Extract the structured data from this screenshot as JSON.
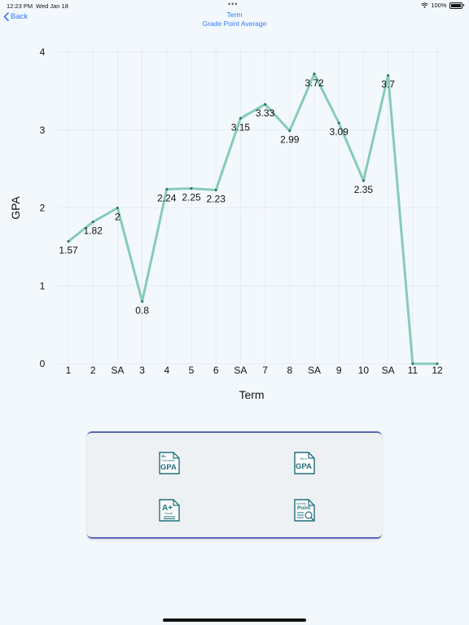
{
  "status_bar": {
    "time": "12:23 PM",
    "date": "Wed Jan 18",
    "battery": "100%"
  },
  "nav": {
    "back_label": "Back",
    "title": "Term",
    "subtitle": "Grade Point Average"
  },
  "chart_data": {
    "type": "line",
    "xlabel": "Term",
    "ylabel": "GPA",
    "ylim": [
      0,
      4
    ],
    "yticks": [
      0,
      1,
      2,
      3,
      4
    ],
    "grid": true,
    "categories": [
      "1",
      "2",
      "SA",
      "3",
      "4",
      "5",
      "6",
      "SA",
      "7",
      "8",
      "SA",
      "9",
      "10",
      "SA",
      "11",
      "12"
    ],
    "values": [
      1.57,
      1.82,
      2,
      0.8,
      2.24,
      2.25,
      2.23,
      3.15,
      3.33,
      2.99,
      3.72,
      3.09,
      2.35,
      3.7,
      0,
      0
    ],
    "data_labels": [
      "1.57",
      "1.82",
      "2",
      "0.8",
      "2.24",
      "2.25",
      "2.23",
      "3.15",
      "3.33",
      "2.99",
      "3.72",
      "3.09",
      "2.35",
      "3.7",
      "",
      ""
    ],
    "line_color": "#86cbb9"
  },
  "menu": {
    "tiles": [
      {
        "name": "cumulative-gpa-button",
        "icon": "cumulative-gpa-icon",
        "small_text": "Cumulative",
        "big_text": "GPA"
      },
      {
        "name": "term-gpa-button",
        "icon": "term-gpa-icon",
        "small_text": "Term",
        "big_text": "GPA"
      },
      {
        "name": "score-button",
        "icon": "score-icon",
        "small_text": "Score",
        "big_text": "A+"
      },
      {
        "name": "activity-point-button",
        "icon": "activity-point-icon",
        "small_text": "Activity",
        "big_text": "Point"
      }
    ]
  },
  "colors": {
    "accent": "#3478f6",
    "icon_teal": "#1f6e7d",
    "panel_border": "#5a67b8"
  }
}
